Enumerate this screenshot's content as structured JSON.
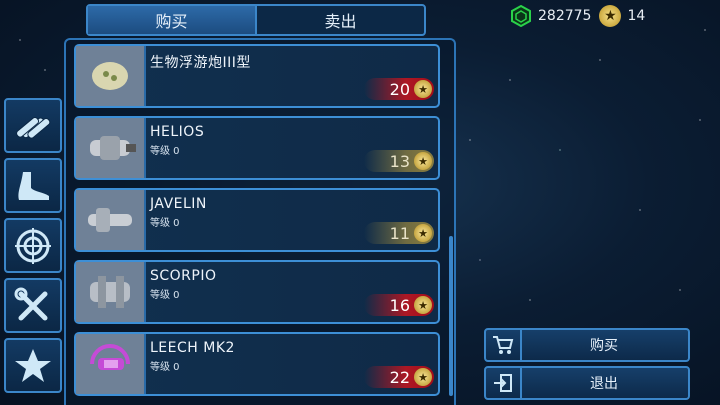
{
  "tabs": {
    "buy": "购买",
    "sell": "卖出"
  },
  "currency": {
    "credits": "282775",
    "stars": "14"
  },
  "sidebar": {
    "items": [
      {
        "icon": "missiles-icon"
      },
      {
        "icon": "boot-icon"
      },
      {
        "icon": "target-icon"
      },
      {
        "icon": "tools-icon"
      },
      {
        "icon": "star-icon"
      }
    ]
  },
  "items": [
    {
      "name": "生物浮游炮III型",
      "level": "",
      "price": "20",
      "price_style": "red"
    },
    {
      "name": "HELIOS",
      "level": "等级 0",
      "price": "13",
      "price_style": "gold"
    },
    {
      "name": "JAVELIN",
      "level": "等级 0",
      "price": "11",
      "price_style": "gold"
    },
    {
      "name": "SCORPIO",
      "level": "等级 0",
      "price": "16",
      "price_style": "red"
    },
    {
      "name": "LEECH MK2",
      "level": "等级 0",
      "price": "22",
      "price_style": "red"
    }
  ],
  "actions": {
    "buy": "购买",
    "exit": "退出"
  },
  "colors": {
    "accent": "#3b86c9",
    "credit_green": "#2ad14a",
    "price_red": "#c8141e",
    "price_gold": "#bea03c"
  }
}
